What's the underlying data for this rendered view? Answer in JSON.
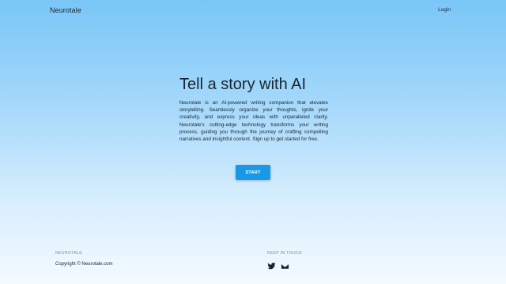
{
  "header": {
    "brand": "Neurotale",
    "login_label": "Login"
  },
  "hero": {
    "title": "Tell a story with AI",
    "description": "Neurotale is an AI-powered writing companion that elevates storytelling. Seamlessly organize your thoughts, ignite your creativity, and express your ideas with unparalleled clarity. Neurotale's cutting-edge technology transforms your writing process, guiding you through the journey of crafting compelling narratives and insightful content. Sign up to get started for free.",
    "start_label": "START"
  },
  "footer": {
    "brand": "NEUROTALE",
    "copyright": "Copyright © Neurotale.com",
    "keep_in_touch": "KEEP IN TOUCH",
    "social_icons": [
      "twitter-icon",
      "mail-icon"
    ]
  },
  "colors": {
    "accent": "#1898e6",
    "background_top": "#79c6f7",
    "background_bottom": "#f4faff",
    "text": "#1b2530",
    "muted": "#7f8b96"
  }
}
